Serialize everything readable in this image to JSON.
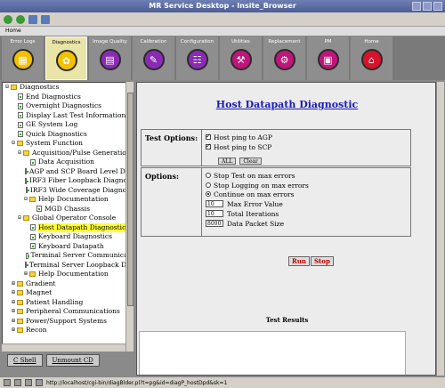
{
  "window": {
    "title": "MR Service Desktop - Insite_Browser"
  },
  "homebar": {
    "label": "Home"
  },
  "nav": [
    {
      "label": "Error Logs",
      "icon": "error-logs-icon",
      "color": "#f4c000",
      "glyph": "▦"
    },
    {
      "label": "Diagnostics",
      "icon": "diagnostics-icon",
      "color": "#f4c000",
      "glyph": "✿"
    },
    {
      "label": "Image Quality",
      "icon": "image-quality-icon",
      "color": "#8b2bb5",
      "glyph": "▤"
    },
    {
      "label": "Calibration",
      "icon": "calibration-icon",
      "color": "#8b2bb5",
      "glyph": "✎"
    },
    {
      "label": "Configuration",
      "icon": "configuration-icon",
      "color": "#8b2bb5",
      "glyph": "☷"
    },
    {
      "label": "Utilities",
      "icon": "utilities-icon",
      "color": "#c0157a",
      "glyph": "⚒"
    },
    {
      "label": "Replacement",
      "icon": "replacement-icon",
      "color": "#c0157a",
      "glyph": "⚙"
    },
    {
      "label": "PM",
      "icon": "pm-icon",
      "color": "#c0157a",
      "glyph": "▣"
    },
    {
      "label": "Home",
      "icon": "home-icon",
      "color": "#d8122a",
      "glyph": "⌂"
    }
  ],
  "tree": [
    {
      "label": "Diagnostics",
      "type": "folder",
      "level": 0,
      "exp": "⊟"
    },
    {
      "label": "End Diagnostics",
      "type": "doc",
      "level": 1
    },
    {
      "label": "Overnight Diagnostics",
      "type": "doc",
      "level": 1
    },
    {
      "label": "Display Last Test Information",
      "type": "doc",
      "level": 1
    },
    {
      "label": "GE System Log",
      "type": "doc",
      "level": 1
    },
    {
      "label": "Quick Diagnostics",
      "type": "doc",
      "level": 1
    },
    {
      "label": "System Function",
      "type": "folder",
      "level": 1,
      "exp": "⊟"
    },
    {
      "label": "Acquisition/Pulse Generation",
      "type": "folder",
      "level": 2,
      "exp": "⊟"
    },
    {
      "label": "Data Acquisition",
      "type": "doc",
      "level": 3
    },
    {
      "label": "AGP and SCP Board Level Diag",
      "type": "doc",
      "level": 3
    },
    {
      "label": "IRF3 Fiber Loopback Diagnost",
      "type": "doc",
      "level": 3
    },
    {
      "label": "IRF3 Wide Coverage Diagnost",
      "type": "doc",
      "level": 3
    },
    {
      "label": "Help Documentation",
      "type": "folder",
      "level": 3,
      "exp": "⊟"
    },
    {
      "label": "MGD Chassis",
      "type": "doc",
      "level": 4
    },
    {
      "label": "Global Operator Console",
      "type": "folder",
      "level": 2,
      "exp": "⊟"
    },
    {
      "label": "Host Datapath Diagnostic",
      "type": "doc",
      "level": 3,
      "selected": true
    },
    {
      "label": "Keyboard Diagnostics",
      "type": "doc",
      "level": 3
    },
    {
      "label": "Keyboard Datapath",
      "type": "doc",
      "level": 3
    },
    {
      "label": "Terminal Server Communicati",
      "type": "doc",
      "level": 3
    },
    {
      "label": "Terminal Server Loopback Dia",
      "type": "doc",
      "level": 3
    },
    {
      "label": "Help Documentation",
      "type": "folder",
      "level": 3,
      "exp": "⊞"
    },
    {
      "label": "Gradient",
      "type": "folder",
      "level": 1,
      "exp": "⊞"
    },
    {
      "label": "Magnet",
      "type": "folder",
      "level": 1,
      "exp": "⊞"
    },
    {
      "label": "Patient Handling",
      "type": "folder",
      "level": 1,
      "exp": "⊞"
    },
    {
      "label": "Peripheral Communications",
      "type": "folder",
      "level": 1,
      "exp": "⊞"
    },
    {
      "label": "Power/Support Systems",
      "type": "folder",
      "level": 1,
      "exp": "⊞"
    },
    {
      "label": "Recon",
      "type": "folder",
      "level": 1,
      "exp": "⊞"
    }
  ],
  "lower_buttons": {
    "cshell": "C Shell",
    "unmount": "Unmount CD"
  },
  "main": {
    "title": "Host Datapath Diagnostic",
    "test_options": {
      "label": "Test Options:",
      "ping_agp": "Host ping to AGP",
      "ping_scp": "Host ping to SCP",
      "all": "ALL",
      "clear": "Clear"
    },
    "options": {
      "label": "Options:",
      "stop_test": "Stop Test on max errors",
      "stop_logging": "Stop Logging on max errors",
      "continue": "Continue on max errors",
      "max_error_value": "10",
      "max_error_label": "Max Error Value",
      "total_iterations_value": "10",
      "total_iterations_label": "Total Iterations",
      "packet_size_value": "8000",
      "packet_size_label": "Data Packet Size"
    },
    "run": "Run",
    "stop": "Stop",
    "results_label": "Test Results"
  },
  "status": {
    "url": "http://localhost/cgi-bin/diagBlder.pl?t=pg&id=diagP_hostDpd&sk=1"
  }
}
